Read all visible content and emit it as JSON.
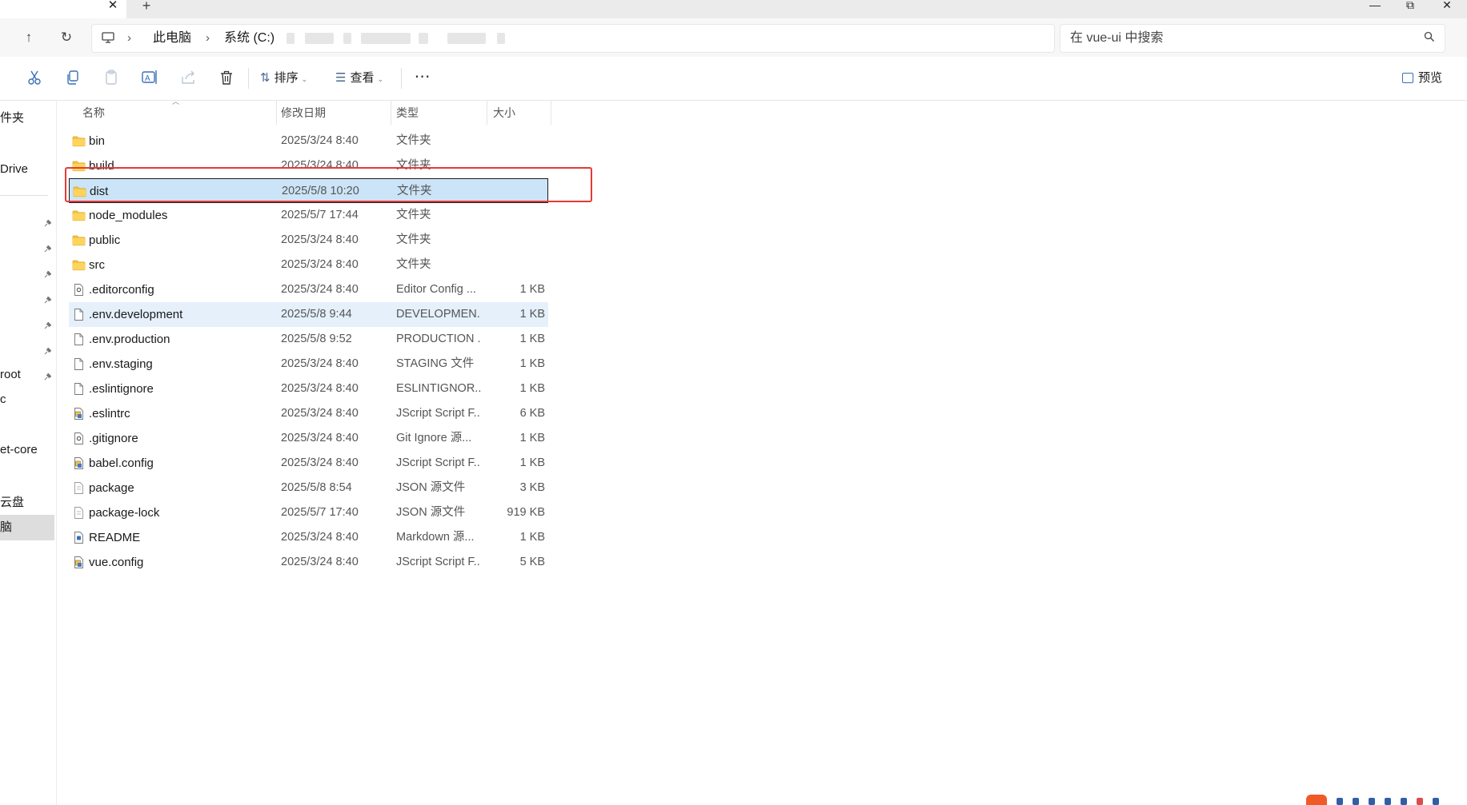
{
  "tabs": {
    "close_glyph": "✕",
    "add_glyph": "+"
  },
  "window": {
    "min_glyph": "—",
    "max_glyph": "⧉",
    "close_glyph": "✕"
  },
  "nav": {
    "up_glyph": "↑",
    "refresh_glyph": "↻"
  },
  "address": {
    "segments": [
      "此电脑",
      "系统 (C:)"
    ],
    "chevron": "›"
  },
  "search": {
    "placeholder": "在 vue-ui 中搜索"
  },
  "toolbar": {
    "sort_label": "排序",
    "sort_glyph": "⇅",
    "view_label": "查看",
    "view_glyph": "☰",
    "caret": "⌄",
    "more_glyph": "⋯",
    "preview_label": "预览",
    "icons": [
      "cut-icon",
      "copy-icon",
      "paste-icon",
      "rename-icon",
      "share-icon",
      "delete-icon"
    ]
  },
  "sidebar": {
    "items": [
      {
        "label": "件夹"
      },
      {
        "label": "Drive"
      },
      {
        "label": "root"
      },
      {
        "label": "c"
      },
      {
        "label": "et-core"
      },
      {
        "label": "云盘"
      },
      {
        "label": "脑"
      }
    ]
  },
  "columns": {
    "name": "名称",
    "date": "修改日期",
    "type": "类型",
    "size": "大小"
  },
  "files": [
    {
      "name": "bin",
      "date": "2025/3/24 8:40",
      "type": "文件夹",
      "size": "",
      "icon": "folder-icon"
    },
    {
      "name": "build",
      "date": "2025/3/24 8:40",
      "type": "文件夹",
      "size": "",
      "icon": "folder-icon"
    },
    {
      "name": "dist",
      "date": "2025/5/8 10:20",
      "type": "文件夹",
      "size": "",
      "icon": "folder-icon"
    },
    {
      "name": "node_modules",
      "date": "2025/5/7 17:44",
      "type": "文件夹",
      "size": "",
      "icon": "folder-icon"
    },
    {
      "name": "public",
      "date": "2025/3/24 8:40",
      "type": "文件夹",
      "size": "",
      "icon": "folder-icon"
    },
    {
      "name": "src",
      "date": "2025/3/24 8:40",
      "type": "文件夹",
      "size": "",
      "icon": "folder-icon"
    },
    {
      "name": ".editorconfig",
      "date": "2025/3/24 8:40",
      "type": "Editor Config ...",
      "size": "1 KB",
      "icon": "config-file-icon"
    },
    {
      "name": ".env.development",
      "date": "2025/5/8 9:44",
      "type": "DEVELOPMEN...",
      "size": "1 KB",
      "icon": "file-icon"
    },
    {
      "name": ".env.production",
      "date": "2025/5/8 9:52",
      "type": "PRODUCTION ...",
      "size": "1 KB",
      "icon": "file-icon"
    },
    {
      "name": ".env.staging",
      "date": "2025/3/24 8:40",
      "type": "STAGING 文件",
      "size": "1 KB",
      "icon": "file-icon"
    },
    {
      "name": ".eslintignore",
      "date": "2025/3/24 8:40",
      "type": "ESLINTIGNOR...",
      "size": "1 KB",
      "icon": "file-icon"
    },
    {
      "name": ".eslintrc",
      "date": "2025/3/24 8:40",
      "type": "JScript Script F...",
      "size": "6 KB",
      "icon": "script-file-icon"
    },
    {
      "name": ".gitignore",
      "date": "2025/3/24 8:40",
      "type": "Git Ignore 源...",
      "size": "1 KB",
      "icon": "config-file-icon"
    },
    {
      "name": "babel.config",
      "date": "2025/3/24 8:40",
      "type": "JScript Script F...",
      "size": "1 KB",
      "icon": "script-file-icon"
    },
    {
      "name": "package",
      "date": "2025/5/8 8:54",
      "type": "JSON 源文件",
      "size": "3 KB",
      "icon": "json-file-icon"
    },
    {
      "name": "package-lock",
      "date": "2025/5/7 17:40",
      "type": "JSON 源文件",
      "size": "919 KB",
      "icon": "json-file-icon"
    },
    {
      "name": "README",
      "date": "2025/3/24 8:40",
      "type": "Markdown 源...",
      "size": "1 KB",
      "icon": "markdown-file-icon"
    },
    {
      "name": "vue.config",
      "date": "2025/3/24 8:40",
      "type": "JScript Script F...",
      "size": "5 KB",
      "icon": "script-file-icon"
    }
  ],
  "selected_file": "dist",
  "hovered_file": ".env.development",
  "colors": {
    "selection": "#cce4f7",
    "hover": "#e5f0fb",
    "highlight_box": "#e53935",
    "folder": "#f5c342"
  }
}
